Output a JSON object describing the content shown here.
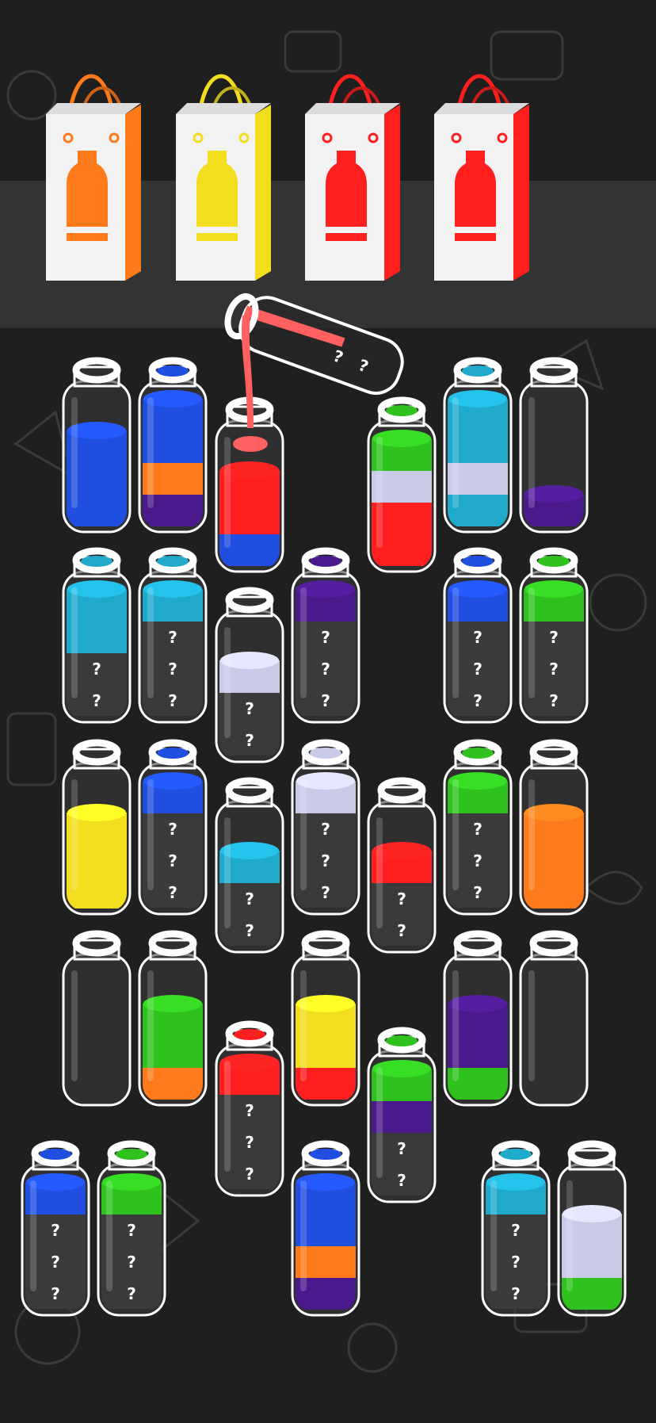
{
  "game": {
    "hidden_marker": "?",
    "colors": {
      "blue": "#1f4ee0",
      "orange": "#ff7a1a",
      "purple": "#4a1a8c",
      "red": "#ff1f1f",
      "green": "#2fc21f",
      "lavender": "#c9c9e8",
      "cyan": "#1faacc",
      "yellow": "#f2dd1f",
      "coral": "#ff6060"
    },
    "bags": [
      {
        "color": "orange"
      },
      {
        "color": "yellow"
      },
      {
        "color": "red"
      },
      {
        "color": "red"
      }
    ],
    "pouring_bottle": {
      "layers": [
        "coral",
        "hidden",
        "hidden"
      ]
    },
    "bottles": [
      {
        "layers": [
          "blue",
          "blue",
          "blue"
        ]
      },
      {
        "layers": [
          "purple",
          "orange",
          "blue",
          "blue"
        ]
      },
      {
        "layers": [
          "blue",
          "red",
          "red"
        ]
      },
      {
        "layers": [
          "red",
          "red",
          "lavender",
          "green"
        ]
      },
      {
        "layers": [
          "cyan",
          "lavender",
          "cyan",
          "cyan"
        ]
      },
      {
        "layers": [
          "purple"
        ]
      },
      {
        "layers": [
          "hidden",
          "hidden",
          "cyan",
          "cyan"
        ]
      },
      {
        "layers": [
          "hidden",
          "hidden",
          "hidden",
          "cyan"
        ]
      },
      {
        "layers": [
          "hidden",
          "hidden",
          "lavender"
        ]
      },
      {
        "layers": [
          "hidden",
          "hidden",
          "hidden",
          "purple"
        ]
      },
      {
        "layers": [
          "hidden",
          "hidden",
          "hidden",
          "blue"
        ]
      },
      {
        "layers": [
          "hidden",
          "hidden",
          "hidden",
          "green"
        ]
      },
      {
        "layers": [
          "yellow",
          "yellow",
          "yellow"
        ]
      },
      {
        "layers": [
          "hidden",
          "hidden",
          "hidden",
          "blue"
        ]
      },
      {
        "layers": [
          "hidden",
          "hidden",
          "cyan"
        ]
      },
      {
        "layers": [
          "hidden",
          "hidden",
          "hidden",
          "lavender"
        ]
      },
      {
        "layers": [
          "hidden",
          "hidden",
          "red"
        ]
      },
      {
        "layers": [
          "hidden",
          "hidden",
          "hidden",
          "green"
        ]
      },
      {
        "layers": [
          "orange",
          "orange",
          "orange"
        ]
      },
      {
        "layers": []
      },
      {
        "layers": [
          "orange",
          "green",
          "green"
        ]
      },
      {
        "layers": [
          "hidden",
          "hidden",
          "hidden",
          "red"
        ]
      },
      {
        "layers": [
          "red",
          "yellow",
          "yellow"
        ]
      },
      {
        "layers": [
          "hidden",
          "hidden",
          "purple",
          "green"
        ]
      },
      {
        "layers": [
          "green",
          "purple",
          "purple"
        ]
      },
      {
        "layers": []
      },
      {
        "layers": [
          "hidden",
          "hidden",
          "hidden",
          "blue"
        ]
      },
      {
        "layers": [
          "hidden",
          "hidden",
          "hidden",
          "green"
        ]
      },
      {
        "layers": [
          "purple",
          "orange",
          "blue",
          "blue"
        ]
      },
      {
        "layers": [
          "hidden",
          "hidden",
          "hidden",
          "cyan"
        ]
      },
      {
        "layers": [
          "green",
          "lavender",
          "lavender"
        ]
      }
    ]
  }
}
